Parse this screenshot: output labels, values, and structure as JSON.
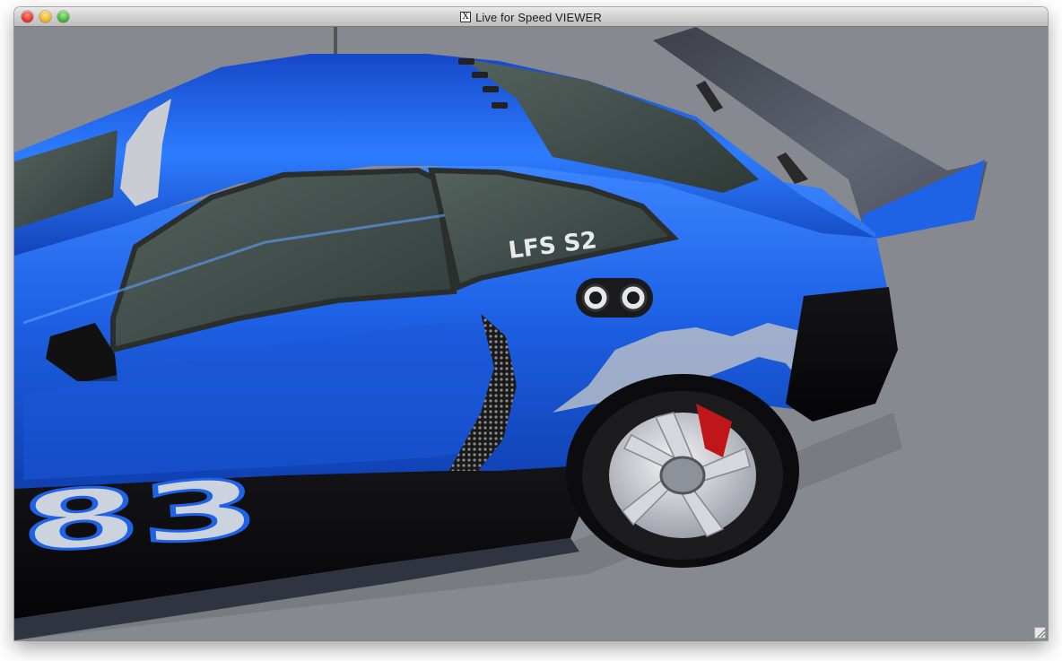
{
  "window": {
    "title": "Live for Speed VIEWER",
    "x11_icon_glyph": "X",
    "controls": [
      "close",
      "minimize",
      "zoom"
    ]
  },
  "scene": {
    "car_window_decal": "LFS S2",
    "car_number": "83",
    "colors": {
      "body": "#1d63e8",
      "background": "#868a90",
      "glass": "#3e4a46",
      "skirt": "#0a0a0c",
      "brake_caliper": "#c0161a"
    }
  }
}
